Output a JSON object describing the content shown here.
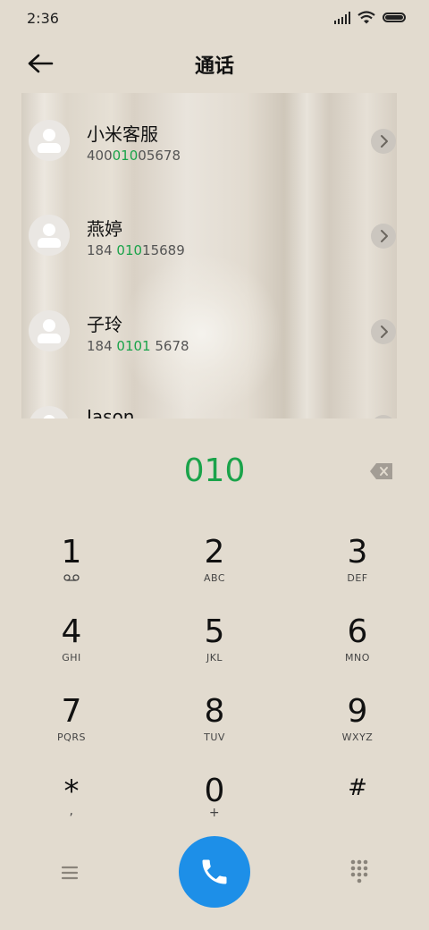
{
  "status_bar": {
    "time": "2:36"
  },
  "header": {
    "title": "通话"
  },
  "contacts": [
    {
      "name": "小米客服",
      "number_parts": [
        "400",
        "010",
        "05678"
      ]
    },
    {
      "name": "燕婷",
      "number_parts": [
        "184 ",
        "010",
        "15689"
      ]
    },
    {
      "name": "子玲",
      "number_parts": [
        "184 ",
        "0101",
        " 5678"
      ]
    },
    {
      "name": "Jason",
      "number_parts": [
        "",
        "",
        ""
      ]
    }
  ],
  "dialer": {
    "typed_number": "010",
    "keys": [
      {
        "digit": "1",
        "letters": ""
      },
      {
        "digit": "2",
        "letters": "ABC"
      },
      {
        "digit": "3",
        "letters": "DEF"
      },
      {
        "digit": "4",
        "letters": "GHI"
      },
      {
        "digit": "5",
        "letters": "JKL"
      },
      {
        "digit": "6",
        "letters": "MNO"
      },
      {
        "digit": "7",
        "letters": "PQRS"
      },
      {
        "digit": "8",
        "letters": "TUV"
      },
      {
        "digit": "9",
        "letters": "WXYZ"
      },
      {
        "digit": "*",
        "letters": ","
      },
      {
        "digit": "0",
        "letters": "+"
      },
      {
        "digit": "#",
        "letters": ""
      }
    ]
  },
  "colors": {
    "accent_green": "#1aa34a",
    "call_blue": "#1d8fe8",
    "background": "#e2dbcf"
  },
  "icons": {
    "back": "arrow-left-icon",
    "backspace": "backspace-icon",
    "voicemail": "voicemail-icon",
    "menu": "menu-icon",
    "call": "phone-icon",
    "dialpad": "dialpad-icon"
  }
}
